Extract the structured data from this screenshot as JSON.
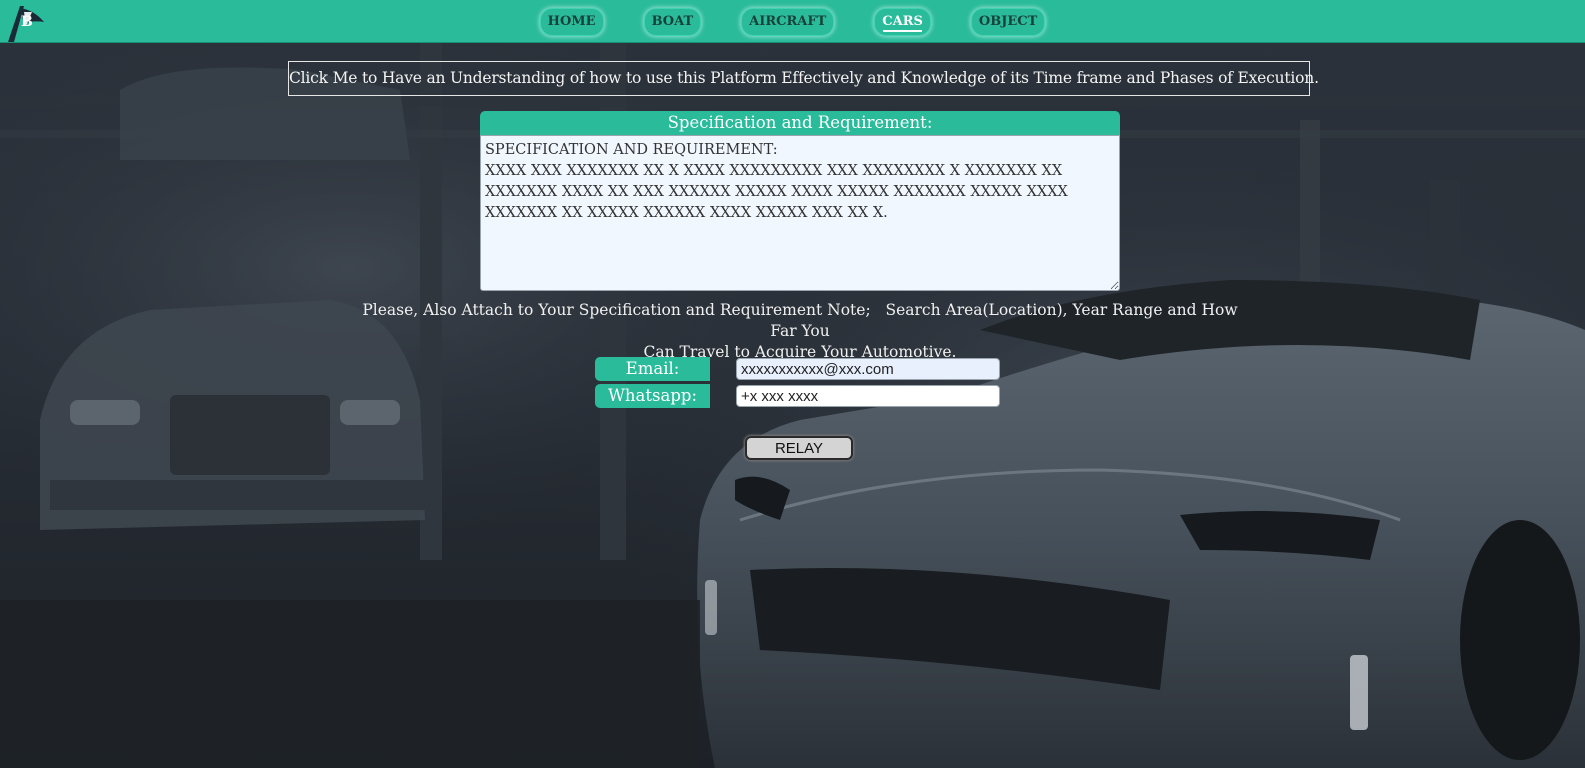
{
  "nav": {
    "items": [
      {
        "label": "HOME",
        "active": false
      },
      {
        "label": "BOAT",
        "active": false
      },
      {
        "label": "AIRCRAFT",
        "active": false
      },
      {
        "label": "CARS",
        "active": true
      },
      {
        "label": "OBJECT",
        "active": false
      }
    ]
  },
  "help_link": {
    "text": "Click Me to Have an Understanding of how to use this Platform Effectively and Knowledge of its Time frame and Phases of Execution."
  },
  "spec": {
    "header": "Specification and Requirement:",
    "value": "SPECIFICATION AND REQUIREMENT:\nXXXX XXX XXXXXXX XX X XXXX XXXXXXXXX XXX XXXXXXXX X XXXXXXX XX XXXXXXX XXXX XX XXX XXXXXX XXXXX XXXX XXXXX XXXXXXX XXXXX XXXX XXXXXXX XX XXXXX XXXXXX XXXX XXXXX XXX XX X."
  },
  "note": {
    "line1": "Please, Also Attach to Your Specification and Requirement Note;   Search Area(Location), Year Range and How Far You",
    "line2": "Can Travel to Acquire Your Automotive."
  },
  "contact": {
    "email_label": "Email:",
    "email_value": "xxxxxxxxxxx@xxx.com",
    "whatsapp_label": "Whatsapp:",
    "whatsapp_value": "+x xxx xxxx"
  },
  "actions": {
    "relay_label": "RELAY"
  },
  "colors": {
    "accent": "#2abb9b",
    "background": "#22272e",
    "nav_text": "#17423a"
  }
}
